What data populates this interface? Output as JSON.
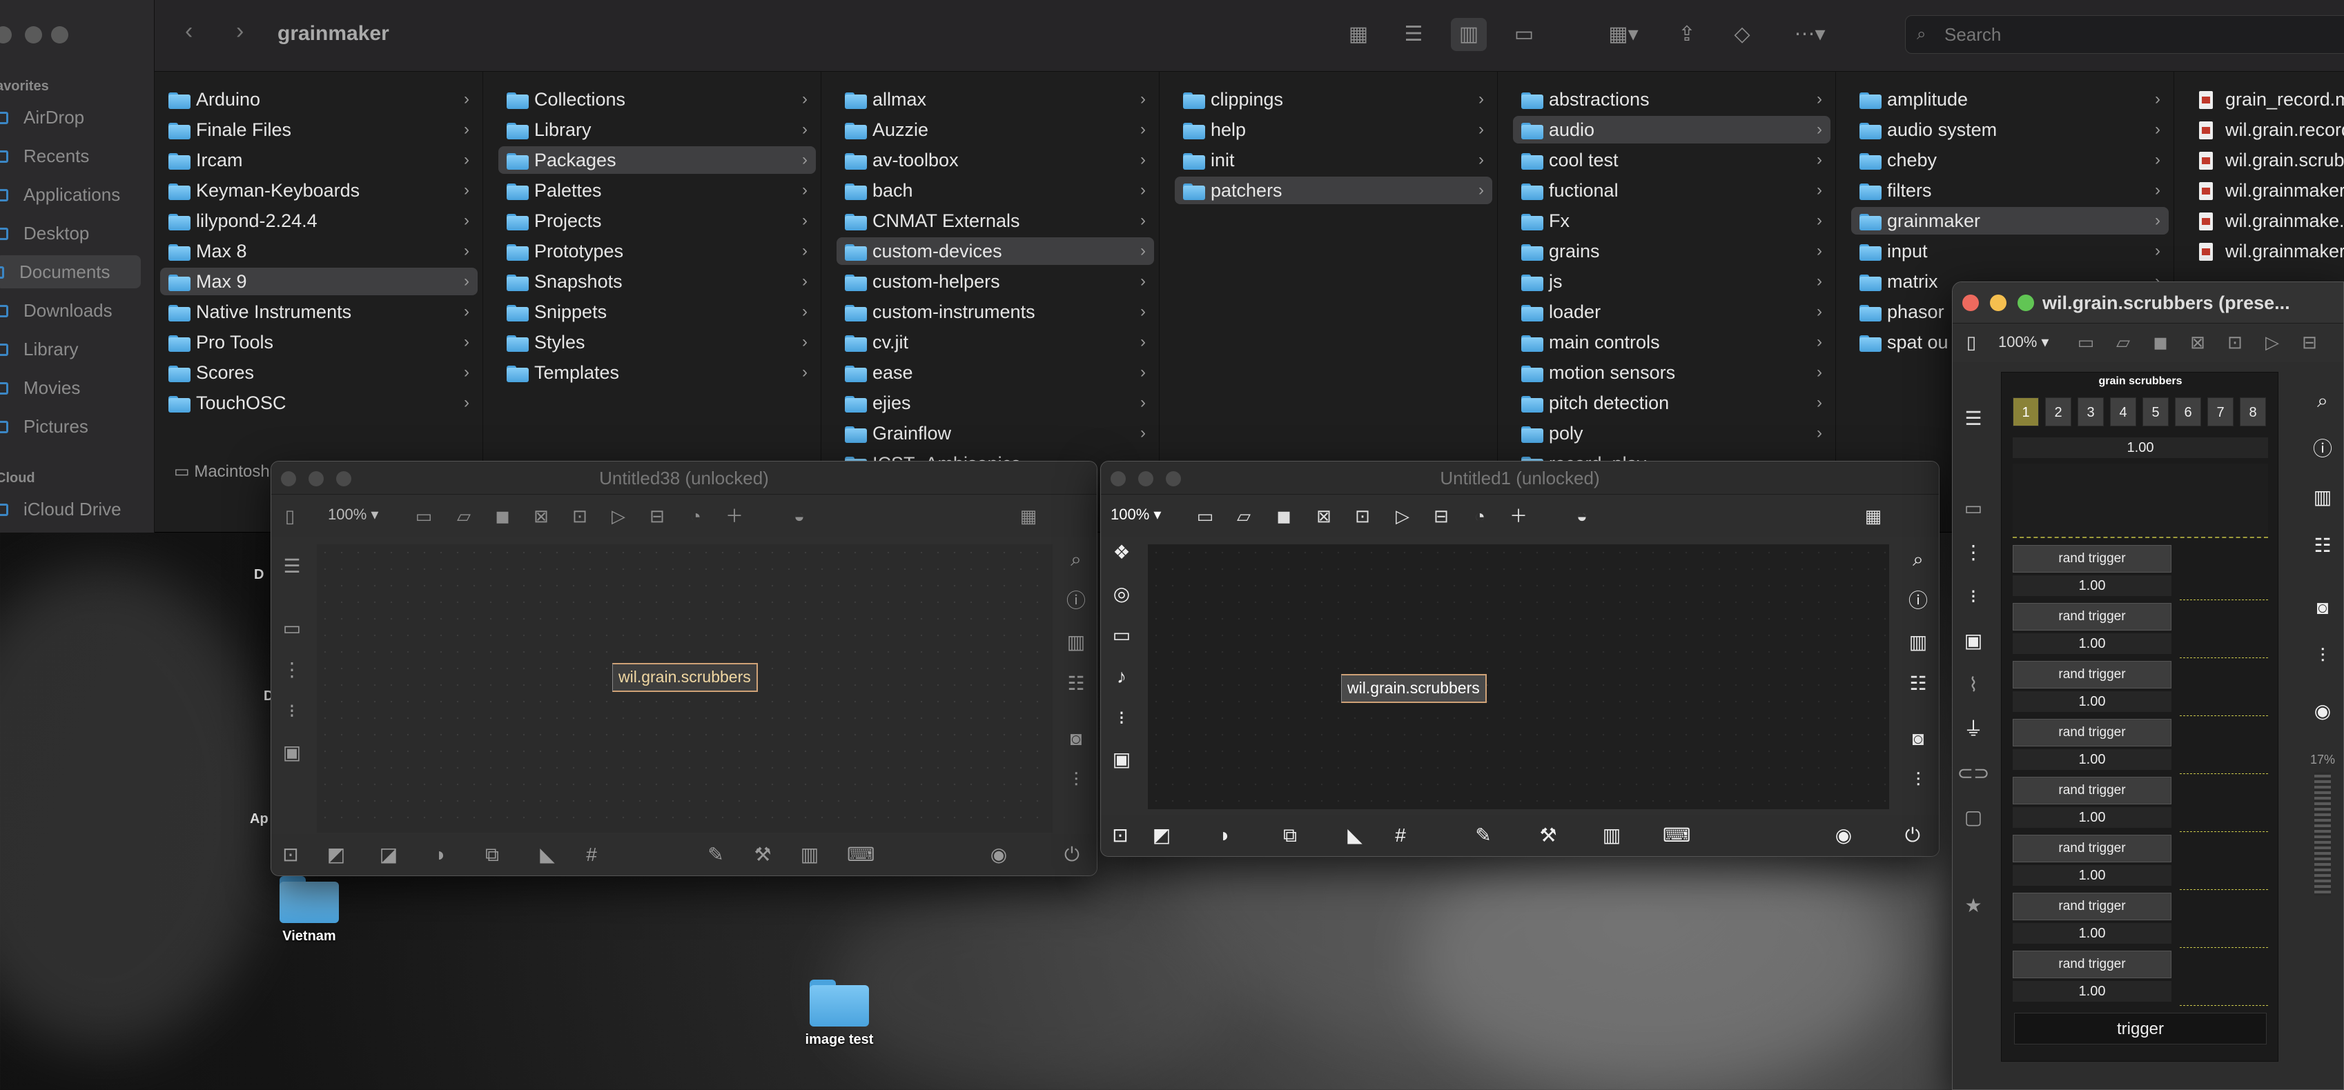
{
  "finder": {
    "title": "grainmaker",
    "search_placeholder": "Search",
    "pathbar_label": "Macintosh",
    "sidebar": {
      "favorites_header": "avorites",
      "cloud_header": "Cloud",
      "items": [
        {
          "label": "AirDrop"
        },
        {
          "label": "Recents"
        },
        {
          "label": "Applications"
        },
        {
          "label": "Desktop"
        },
        {
          "label": "Documents",
          "selected": true
        },
        {
          "label": "Downloads"
        },
        {
          "label": "Library"
        },
        {
          "label": "Movies"
        },
        {
          "label": "Pictures"
        }
      ],
      "cloud_item": "iCloud Drive"
    },
    "columns": [
      {
        "items": [
          "Arduino",
          "Finale Files",
          "Ircam",
          "Keyman-Keyboards",
          "lilypond-2.24.4",
          "Max 8",
          "Max 9",
          "Native Instruments",
          "Pro Tools",
          "Scores",
          "TouchOSC"
        ],
        "selected": "Max 9"
      },
      {
        "items": [
          "Collections",
          "Library",
          "Packages",
          "Palettes",
          "Projects",
          "Prototypes",
          "Snapshots",
          "Snippets",
          "Styles",
          "Templates"
        ],
        "selected": "Packages"
      },
      {
        "items": [
          "allmax",
          "Auzzie",
          "av-toolbox",
          "bach",
          "CNMAT Externals",
          "custom-devices",
          "custom-helpers",
          "custom-instruments",
          "cv.jit",
          "ease",
          "ejies",
          "Grainflow",
          "ICST_Ambisonics"
        ],
        "selected": "custom-devices"
      },
      {
        "items": [
          "clippings",
          "help",
          "init",
          "patchers"
        ],
        "selected": "patchers"
      },
      {
        "items": [
          "abstractions",
          "audio",
          "cool test",
          "fuctional",
          "Fx",
          "grains",
          "js",
          "loader",
          "main controls",
          "motion sensors",
          "pitch detection",
          "poly",
          "record_play"
        ],
        "selected": "audio"
      },
      {
        "items": [
          "amplitude",
          "audio system",
          "cheby",
          "filters",
          "grainmaker",
          "input",
          "matrix",
          "phasor",
          "spat ou"
        ],
        "selected": "grainmaker"
      },
      {
        "items": [
          "grain_record.m",
          "wil.grain.record",
          "wil.grain.scrub",
          "wil.grainmaker",
          "wil.grainmake.",
          "wil.grainmaker"
        ],
        "selected": ""
      }
    ]
  },
  "desktop": {
    "icons": [
      {
        "label": "Vietnam"
      },
      {
        "label": "image test"
      }
    ],
    "partial_labels": [
      "D",
      "D",
      "Ap"
    ]
  },
  "max_windows": [
    {
      "title": "Untitled38 (unlocked)",
      "zoom": "100% ▾",
      "object_text": "wil.grain.scrubbers"
    },
    {
      "title": "Untitled1 (unlocked)",
      "zoom": "100% ▾",
      "object_text": "wil.grain.scrubbers"
    }
  ],
  "presentation": {
    "title": "wil.grain.scrubbers (prese...",
    "zoom": "100% ▾",
    "panel_title": "grain scrubbers",
    "tabs": [
      "1",
      "2",
      "3",
      "4",
      "5",
      "6",
      "7",
      "8"
    ],
    "active_tab": "1",
    "master_value": "1.00",
    "rows": [
      {
        "button": "rand trigger",
        "value": "1.00"
      },
      {
        "button": "rand trigger",
        "value": "1.00"
      },
      {
        "button": "rand trigger",
        "value": "1.00"
      },
      {
        "button": "rand trigger",
        "value": "1.00"
      },
      {
        "button": "rand trigger",
        "value": "1.00"
      },
      {
        "button": "rand trigger",
        "value": "1.00"
      },
      {
        "button": "rand trigger",
        "value": "1.00"
      },
      {
        "button": "rand trigger",
        "value": "1.00"
      }
    ],
    "trigger_label": "trigger",
    "cpu_percent": "17%"
  },
  "colors": {
    "folder_blue": "#4aa3de",
    "object_border": "#cfa277",
    "active_tab": "#8a8238",
    "close_red": "#ed6a5e",
    "min_yellow": "#f5bf4f",
    "max_green": "#61c554"
  }
}
